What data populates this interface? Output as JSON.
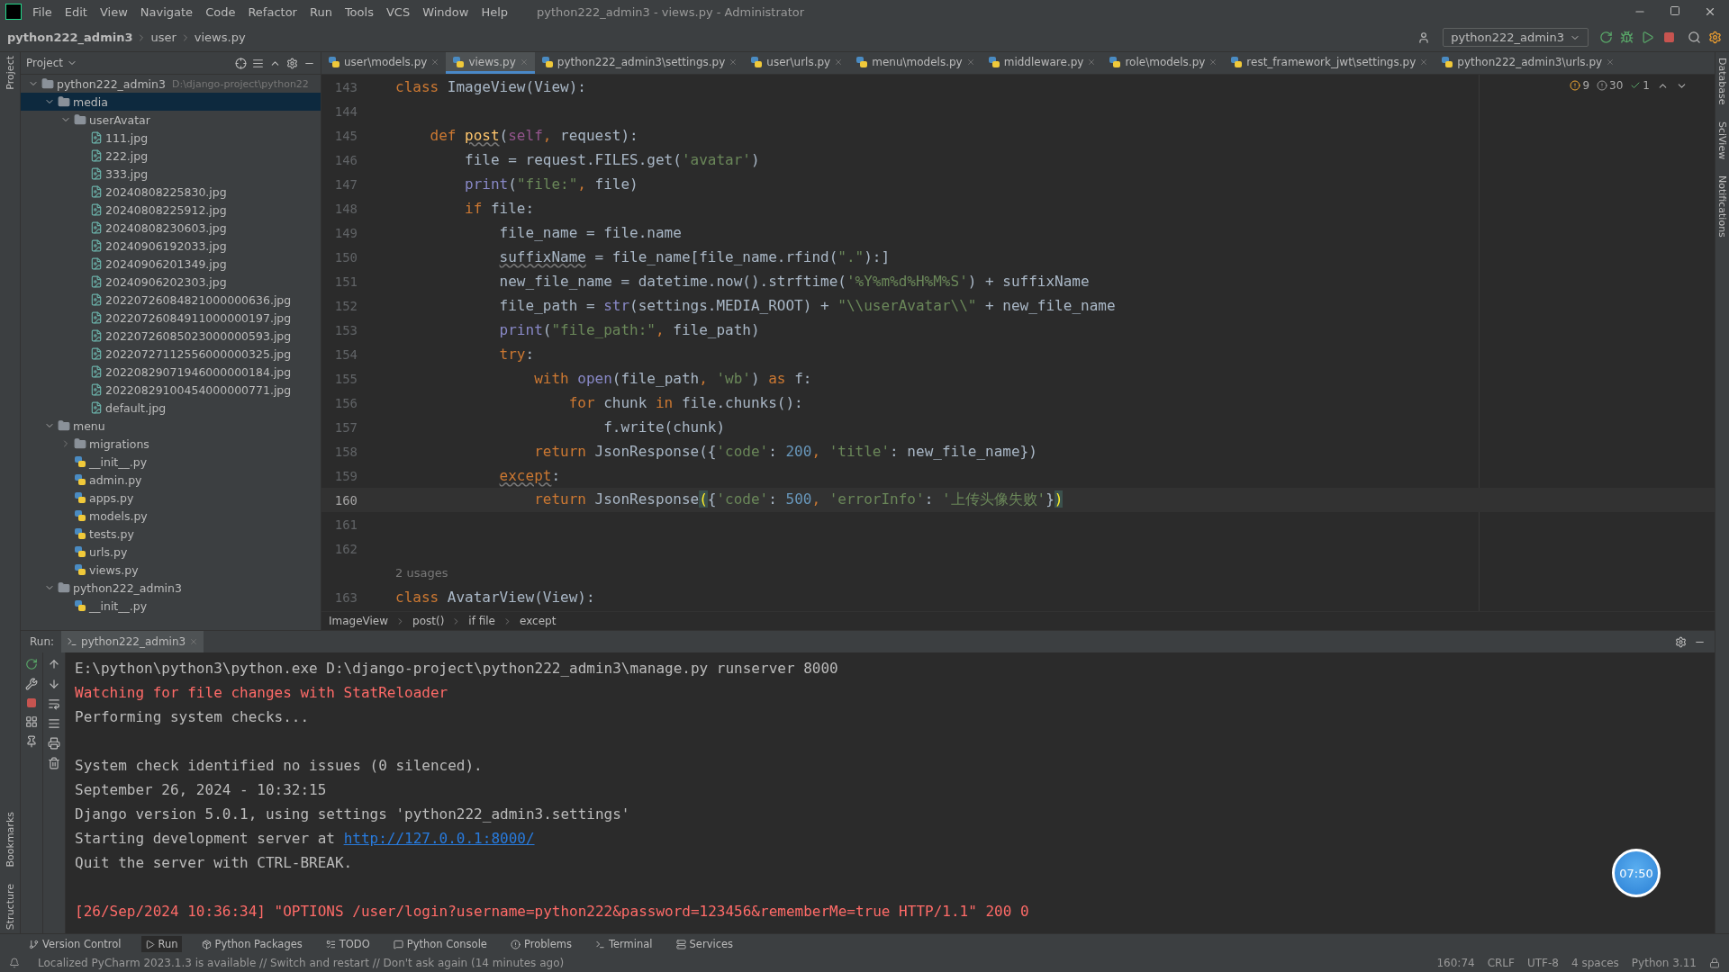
{
  "title_bar": {
    "menus": [
      "File",
      "Edit",
      "View",
      "Navigate",
      "Code",
      "Refactor",
      "Run",
      "Tools",
      "VCS",
      "Window",
      "Help"
    ],
    "title": "python222_admin3 - views.py - Administrator"
  },
  "nav_bar": {
    "crumbs": [
      "python222_admin3",
      "user",
      "views.py"
    ],
    "run_config": "python222_admin3"
  },
  "left_strip": {
    "top": [
      "Project"
    ],
    "bottom": [
      "Bookmarks",
      "Structure"
    ]
  },
  "right_strip": [
    "Database",
    "SciView",
    "Notifications"
  ],
  "project_panel": {
    "title": "Project",
    "tree": [
      {
        "label": "python222_admin3",
        "path": "D:\\django-project\\python22",
        "kind": "folder",
        "expanded": true,
        "selected": false,
        "children": [
          {
            "label": "media",
            "kind": "folder",
            "expanded": true,
            "selected": true,
            "children": [
              {
                "label": "userAvatar",
                "kind": "folder",
                "expanded": true,
                "selected": false,
                "children": [
                  {
                    "label": "111.jpg",
                    "kind": "image",
                    "selected": false
                  },
                  {
                    "label": "222.jpg",
                    "kind": "image",
                    "selected": false
                  },
                  {
                    "label": "333.jpg",
                    "kind": "image",
                    "selected": false
                  },
                  {
                    "label": "20240808225830.jpg",
                    "kind": "image",
                    "selected": false
                  },
                  {
                    "label": "20240808225912.jpg",
                    "kind": "image",
                    "selected": false
                  },
                  {
                    "label": "20240808230603.jpg",
                    "kind": "image",
                    "selected": false
                  },
                  {
                    "label": "20240906192033.jpg",
                    "kind": "image",
                    "selected": false
                  },
                  {
                    "label": "20240906201349.jpg",
                    "kind": "image",
                    "selected": false
                  },
                  {
                    "label": "20240906202303.jpg",
                    "kind": "image",
                    "selected": false
                  },
                  {
                    "label": "20220726084821000000636.jpg",
                    "kind": "image",
                    "selected": false
                  },
                  {
                    "label": "20220726084911000000197.jpg",
                    "kind": "image",
                    "selected": false
                  },
                  {
                    "label": "20220726085023000000593.jpg",
                    "kind": "image",
                    "selected": false
                  },
                  {
                    "label": "20220727112556000000325.jpg",
                    "kind": "image",
                    "selected": false
                  },
                  {
                    "label": "20220829071946000000184.jpg",
                    "kind": "image",
                    "selected": false
                  },
                  {
                    "label": "20220829100454000000771.jpg",
                    "kind": "image",
                    "selected": false
                  },
                  {
                    "label": "default.jpg",
                    "kind": "image",
                    "selected": false
                  }
                ]
              }
            ]
          },
          {
            "label": "menu",
            "kind": "folder",
            "expanded": true,
            "selected": false,
            "children": [
              {
                "label": "migrations",
                "kind": "folder",
                "expanded": false,
                "selected": false
              },
              {
                "label": "__init__.py",
                "kind": "python",
                "selected": false
              },
              {
                "label": "admin.py",
                "kind": "python",
                "selected": false
              },
              {
                "label": "apps.py",
                "kind": "python",
                "selected": false
              },
              {
                "label": "models.py",
                "kind": "python",
                "selected": false
              },
              {
                "label": "tests.py",
                "kind": "python",
                "selected": false
              },
              {
                "label": "urls.py",
                "kind": "python",
                "selected": false
              },
              {
                "label": "views.py",
                "kind": "python",
                "selected": false
              }
            ]
          },
          {
            "label": "python222_admin3",
            "kind": "folder",
            "expanded": true,
            "selected": false,
            "children": [
              {
                "label": "__init__.py",
                "kind": "python",
                "selected": false
              }
            ]
          }
        ]
      }
    ]
  },
  "editor_tabs": [
    {
      "label": "user\\models.py",
      "selected": false
    },
    {
      "label": "views.py",
      "selected": true
    },
    {
      "label": "python222_admin3\\settings.py",
      "selected": false
    },
    {
      "label": "user\\urls.py",
      "selected": false
    },
    {
      "label": "menu\\models.py",
      "selected": false
    },
    {
      "label": "middleware.py",
      "selected": false
    },
    {
      "label": "role\\models.py",
      "selected": false
    },
    {
      "label": "rest_framework_jwt\\settings.py",
      "selected": false
    },
    {
      "label": "python222_admin3\\urls.py",
      "selected": false
    }
  ],
  "inspections": {
    "warnings": "9",
    "weak_warnings": "30",
    "typos": "1"
  },
  "code_lines": [
    {
      "kind": "code",
      "num": "143",
      "current": false,
      "tokens": [
        {
          "kind": "kw",
          "text": "class "
        },
        {
          "kind": "plain",
          "text": "ImageView(View):"
        }
      ]
    },
    {
      "kind": "code",
      "num": "144",
      "current": false
    },
    {
      "kind": "code",
      "num": "145",
      "current": false,
      "tokens": [
        {
          "kind": "kw",
          "text": "    def "
        },
        {
          "kind": "fn",
          "text": "post"
        },
        {
          "kind": "plain",
          "text": "("
        },
        {
          "kind": "self",
          "text": "self"
        },
        {
          "kind": "kw",
          "text": ", "
        },
        {
          "kind": "plain",
          "text": "request):"
        }
      ]
    },
    {
      "kind": "code",
      "num": "146",
      "current": false,
      "tokens": [
        {
          "kind": "plain",
          "text": "        file = request.FILES.get("
        },
        {
          "kind": "str",
          "text": "'avatar'"
        },
        {
          "kind": "plain",
          "text": ")"
        }
      ]
    },
    {
      "kind": "code",
      "num": "147",
      "current": false,
      "tokens": [
        {
          "kind": "builtin",
          "text": "        print"
        },
        {
          "kind": "plain",
          "text": "("
        },
        {
          "kind": "str",
          "text": "\"file:\""
        },
        {
          "kind": "kw",
          "text": ", "
        },
        {
          "kind": "plain",
          "text": "file)"
        }
      ]
    },
    {
      "kind": "code",
      "num": "148",
      "current": false,
      "tokens": [
        {
          "kind": "kw",
          "text": "        if "
        },
        {
          "kind": "plain",
          "text": "file:"
        }
      ]
    },
    {
      "kind": "code",
      "num": "149",
      "current": false,
      "tokens": [
        {
          "kind": "plain",
          "text": "            file_name = file.name"
        }
      ]
    },
    {
      "kind": "code",
      "num": "150",
      "current": false,
      "tokens": [
        {
          "kind": "typo",
          "text": "            suffixName"
        },
        {
          "kind": "plain",
          "text": " = file_name[file_name.rfind("
        },
        {
          "kind": "str",
          "text": "\".\""
        },
        {
          "kind": "plain",
          "text": "):]"
        }
      ]
    },
    {
      "kind": "code",
      "num": "151",
      "current": false,
      "tokens": [
        {
          "kind": "plain",
          "text": "            new_file_name = datetime.now().strftime("
        },
        {
          "kind": "str",
          "text": "'%Y%m%d%H%M%S'"
        },
        {
          "kind": "plain",
          "text": ") + suffixName"
        }
      ]
    },
    {
      "kind": "code",
      "num": "152",
      "current": false,
      "tokens": [
        {
          "kind": "plain",
          "text": "            file_path = "
        },
        {
          "kind": "builtin",
          "text": "str"
        },
        {
          "kind": "plain",
          "text": "(settings.MEDIA_ROOT) + "
        },
        {
          "kind": "str",
          "text": "\"\\\\userAvatar\\\\\""
        },
        {
          "kind": "plain",
          "text": " + new_file_name"
        }
      ]
    },
    {
      "kind": "code",
      "num": "153",
      "current": false,
      "tokens": [
        {
          "kind": "builtin",
          "text": "            print"
        },
        {
          "kind": "plain",
          "text": "("
        },
        {
          "kind": "str",
          "text": "\"file_path:\""
        },
        {
          "kind": "kw",
          "text": ", "
        },
        {
          "kind": "plain",
          "text": "file_path)"
        }
      ]
    },
    {
      "kind": "code",
      "num": "154",
      "current": false,
      "tokens": [
        {
          "kind": "kw",
          "text": "            try"
        },
        {
          "kind": "plain",
          "text": ":"
        }
      ]
    },
    {
      "kind": "code",
      "num": "155",
      "current": false,
      "tokens": [
        {
          "kind": "kw",
          "text": "                with "
        },
        {
          "kind": "builtin",
          "text": "open"
        },
        {
          "kind": "plain",
          "text": "(file_path"
        },
        {
          "kind": "kw",
          "text": ", "
        },
        {
          "kind": "str",
          "text": "'wb'"
        },
        {
          "kind": "plain",
          "text": ") "
        },
        {
          "kind": "kw",
          "text": "as "
        },
        {
          "kind": "plain",
          "text": "f:"
        }
      ]
    },
    {
      "kind": "code",
      "num": "156",
      "current": false,
      "tokens": [
        {
          "kind": "kw",
          "text": "                    for "
        },
        {
          "kind": "plain",
          "text": "chunk "
        },
        {
          "kind": "kw",
          "text": "in "
        },
        {
          "kind": "plain",
          "text": "file.chunks():"
        }
      ]
    },
    {
      "kind": "code",
      "num": "157",
      "current": false,
      "tokens": [
        {
          "kind": "plain",
          "text": "                        f.write(chunk)"
        }
      ]
    },
    {
      "kind": "code",
      "num": "158",
      "current": false,
      "tokens": [
        {
          "kind": "kw",
          "text": "                return "
        },
        {
          "kind": "plain",
          "text": "JsonResponse({"
        },
        {
          "kind": "str",
          "text": "'code'"
        },
        {
          "kind": "plain",
          "text": ": "
        },
        {
          "kind": "num",
          "text": "200"
        },
        {
          "kind": "kw",
          "text": ", "
        },
        {
          "kind": "str",
          "text": "'title'"
        },
        {
          "kind": "plain",
          "text": ": new_file_name})"
        }
      ]
    },
    {
      "kind": "code",
      "num": "159",
      "current": false,
      "tokens": [
        {
          "kind": "kwtypo",
          "text": "            except"
        },
        {
          "kind": "plain",
          "text": ":"
        }
      ]
    },
    {
      "kind": "code",
      "num": "160",
      "current": true,
      "tokens": [
        {
          "kind": "kw",
          "text": "                return "
        },
        {
          "kind": "plain",
          "text": "JsonResponse"
        },
        {
          "kind": "match",
          "text": "("
        },
        {
          "kind": "plain",
          "text": "{"
        },
        {
          "kind": "str",
          "text": "'code'"
        },
        {
          "kind": "plain",
          "text": ": "
        },
        {
          "kind": "num",
          "text": "500"
        },
        {
          "kind": "kw",
          "text": ", "
        },
        {
          "kind": "str",
          "text": "'errorInfo'"
        },
        {
          "kind": "plain",
          "text": ": "
        },
        {
          "kind": "str",
          "text": "'上传头像失败'"
        },
        {
          "kind": "plain",
          "text": "}"
        },
        {
          "kind": "match",
          "text": ")"
        }
      ]
    },
    {
      "kind": "code",
      "num": "161",
      "current": false
    },
    {
      "kind": "code",
      "num": "162",
      "current": false
    },
    {
      "kind": "hint",
      "text": "2 usages"
    },
    {
      "kind": "code",
      "num": "163",
      "current": false,
      "tokens": [
        {
          "kind": "kw",
          "text": "class "
        },
        {
          "kind": "plain",
          "text": "AvatarView(View):"
        }
      ]
    }
  ],
  "editor_breadcrumbs": [
    "ImageView",
    "post()",
    "if file",
    "except"
  ],
  "run_panel": {
    "label": "Run:",
    "tab": "python222_admin3",
    "lines": [
      {
        "kind": "output",
        "text": "E:\\python\\python3\\python.exe D:\\django-project\\python222_admin3\\manage.py runserver 8000"
      },
      {
        "kind": "error",
        "text": "Watching for file changes with StatReloader"
      },
      {
        "kind": "output",
        "text": "Performing system checks..."
      },
      {
        "kind": "blank"
      },
      {
        "kind": "output",
        "text": "System check identified no issues (0 silenced)."
      },
      {
        "kind": "output",
        "text": "September 26, 2024 - 10:32:15"
      },
      {
        "kind": "output",
        "text": "Django version 5.0.1, using settings 'python222_admin3.settings'"
      },
      {
        "kind": "link",
        "text": "Starting development server at ",
        "link": "http://127.0.0.1:8000/"
      },
      {
        "kind": "output",
        "text": "Quit the server with CTRL-BREAK."
      },
      {
        "kind": "blank"
      },
      {
        "kind": "error",
        "text": "[26/Sep/2024 10:36:34] \"OPTIONS /user/login?username=python222&password=123456&rememberMe=true HTTP/1.1\" 200 0"
      }
    ]
  },
  "timer_badge": "07:50",
  "bottom_tools": [
    {
      "label": "Version Control",
      "selected": false
    },
    {
      "label": "Run",
      "selected": true
    },
    {
      "label": "Python Packages",
      "selected": false
    },
    {
      "label": "TODO",
      "selected": false
    },
    {
      "label": "Python Console",
      "selected": false
    },
    {
      "label": "Problems",
      "selected": false
    },
    {
      "label": "Terminal",
      "selected": false
    },
    {
      "label": "Services",
      "selected": false
    }
  ],
  "status_bar": {
    "message": "Localized PyCharm 2023.1.3 is available // Switch and restart // Don't ask again (14 minutes ago)",
    "items": [
      "160:74",
      "CRLF",
      "UTF-8",
      "4 spaces",
      "Python 3.11"
    ]
  }
}
